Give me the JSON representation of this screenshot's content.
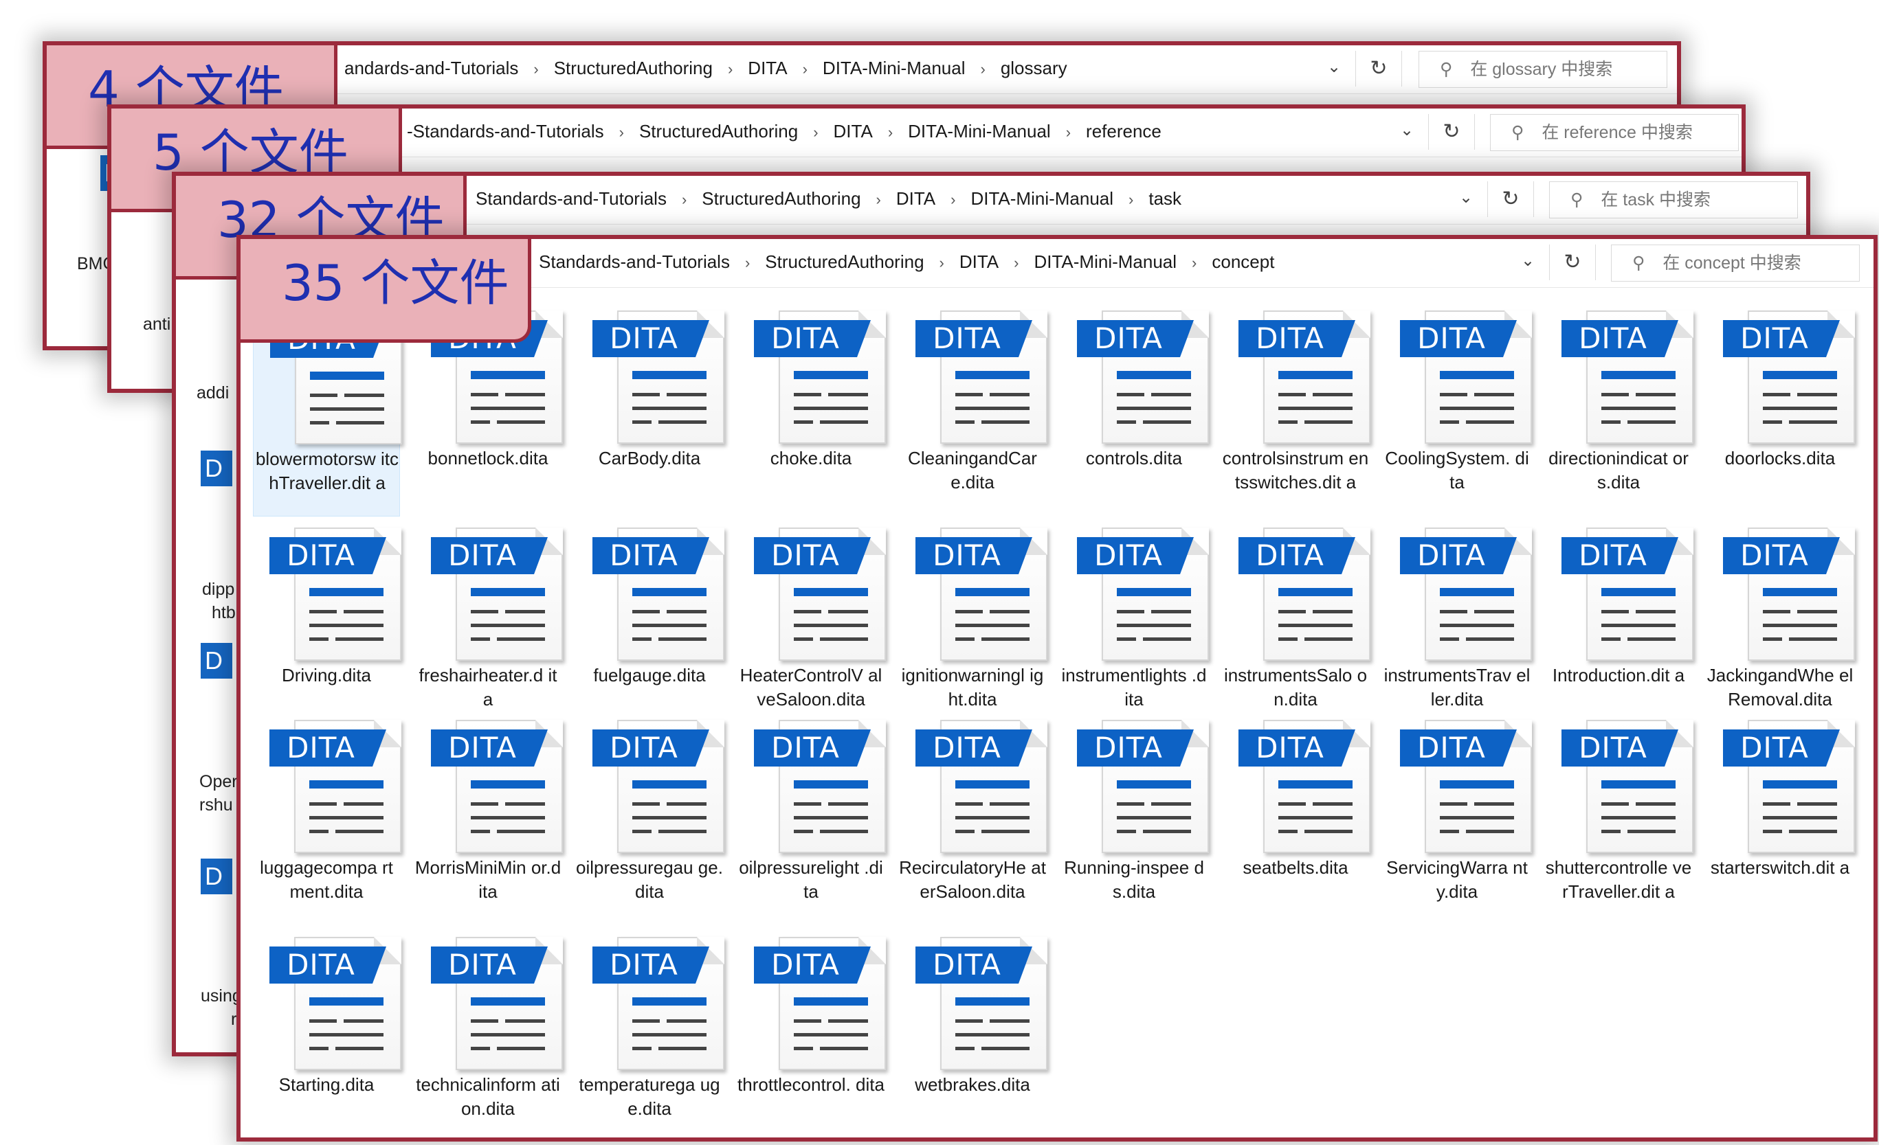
{
  "windows": [
    {
      "badge": "4 个文件",
      "breadcrumb": [
        "andards-and-Tutorials",
        "StructuredAuthoring",
        "DITA",
        "DITA-Mini-Manual",
        "glossary"
      ],
      "search_placeholder": "在 glossary 中搜索",
      "peek": [
        "BMC"
      ]
    },
    {
      "badge": "5 个文件",
      "breadcrumb": [
        "-Standards-and-Tutorials",
        "StructuredAuthoring",
        "DITA",
        "DITA-Mini-Manual",
        "reference"
      ],
      "search_placeholder": "在 reference 中搜索",
      "peek": [
        "anti"
      ]
    },
    {
      "badge": "32 个文件",
      "breadcrumb": [
        "Standards-and-Tutorials",
        "StructuredAuthoring",
        "DITA",
        "DITA-Mini-Manual",
        "task"
      ],
      "search_placeholder": "在 task 中搜索",
      "peek": [
        "addi",
        "dipp",
        "htb",
        "Oper",
        "rshu",
        "using",
        "r"
      ]
    },
    {
      "badge": "35 个文件",
      "breadcrumb": [
        "Standards-and-Tutorials",
        "StructuredAuthoring",
        "DITA",
        "DITA-Mini-Manual",
        "concept"
      ],
      "search_placeholder": "在 concept 中搜索"
    }
  ],
  "icons": {
    "separator": "›",
    "dropdown": "chevron-down-icon",
    "refresh": "refresh-icon",
    "search": "search-icon",
    "file": "dita-file-icon"
  },
  "file_icon_label": "DITA",
  "peek_icon_label": "D",
  "files": [
    "blowermotorsw itchTraveller.dit a",
    "bonnetlock.dita",
    "CarBody.dita",
    "choke.dita",
    "CleaningandCar e.dita",
    "controls.dita",
    "controlsinstrum entsswitches.dit a",
    "CoolingSystem. dita",
    "directionindicat ors.dita",
    "doorlocks.dita",
    "Driving.dita",
    "freshairheater.d ita",
    "fuelgauge.dita",
    "HeaterControlV alveSaloon.dita",
    "ignitionwarningl ight.dita",
    "instrumentlights .dita",
    "instrumentsSalo on.dita",
    "instrumentsTrav eller.dita",
    "Introduction.dit a",
    "JackingandWhe elRemoval.dita",
    "luggagecompa rtment.dita",
    "MorrisMiniMin or.dita",
    "oilpressuregau ge.dita",
    "oilpressurelight .dita",
    "RecirculatoryHe aterSaloon.dita",
    "Running-inspee ds.dita",
    "seatbelts.dita",
    "ServicingWarra nty.dita",
    "shuttercontrolle verTraveller.dit a",
    "starterswitch.dit a",
    "Starting.dita",
    "technicalinform ation.dita",
    "temperaturega uge.dita",
    "throttlecontrol. dita",
    "wetbrakes.dita"
  ],
  "colors": {
    "frame": "#9c2a3c",
    "badge_fill": "#eab1b8",
    "badge_text": "#1f2fb0",
    "dita_blue": "#0d62c5"
  }
}
